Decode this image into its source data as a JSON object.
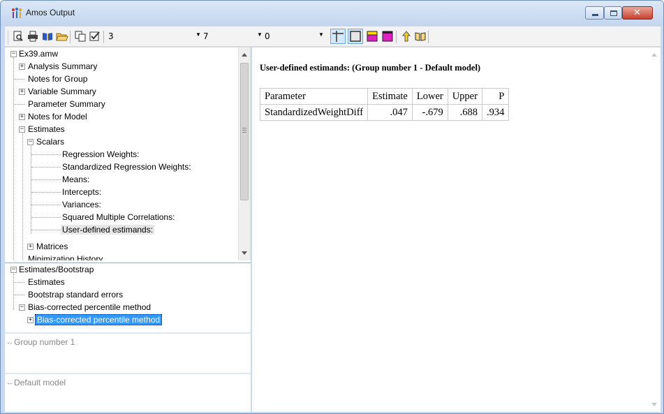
{
  "window": {
    "title": "Amos Output",
    "accent": "#c9daf0",
    "close_color": "#c7402e"
  },
  "toolbar": {
    "icons": [
      "print-preview-icon",
      "print-icon",
      "book-icon",
      "open-folder-icon",
      "copy-icon",
      "options-check-icon"
    ],
    "decimals_value": "3",
    "table_width_value": "7",
    "third_value": "0",
    "view_icons": [
      "grid-lines-icon",
      "frame-icon",
      "magenta-header-icon",
      "magenta-block-icon",
      "pointer-icon",
      "help-book-icon"
    ]
  },
  "tree": {
    "root": "Ex39.amw",
    "items": [
      "Analysis Summary",
      "Notes for Group",
      "Variable Summary",
      "Parameter Summary",
      "Notes for Model",
      "Estimates",
      "Scalars",
      "Regression Weights:",
      "Standardized Regression Weights:",
      "Means:",
      "Intercepts:",
      "Variances:",
      "Squared Multiple Correlations:",
      "User-defined estimands:",
      "Matrices",
      "Minimization History"
    ]
  },
  "bootstrap_tree": {
    "root": "Estimates/Bootstrap",
    "items": [
      "Estimates",
      "Bootstrap standard errors",
      "Bias-corrected percentile method",
      "Bias-corrected percentile method"
    ]
  },
  "groups": {
    "label": "Group number 1"
  },
  "models": {
    "label": "Default model"
  },
  "main": {
    "heading": "User-defined estimands: (Group number 1 - Default model)",
    "table": {
      "headers": [
        "Parameter",
        "Estimate",
        "Lower",
        "Upper",
        "P"
      ],
      "rows": [
        [
          "StandardizedWeightDiff",
          ".047",
          "-.679",
          ".688",
          ".934"
        ]
      ]
    }
  }
}
